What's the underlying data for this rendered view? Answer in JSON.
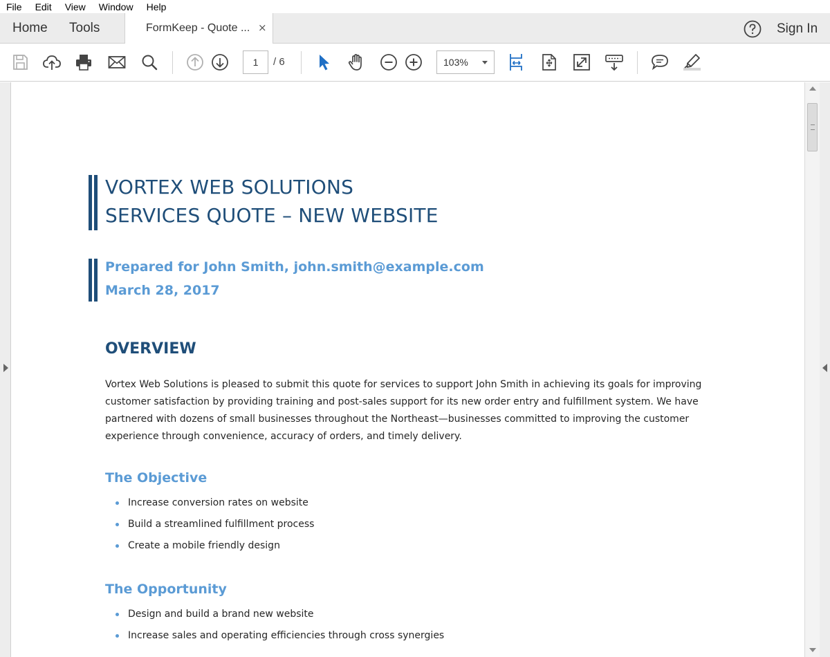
{
  "menu": [
    "File",
    "Edit",
    "View",
    "Window",
    "Help"
  ],
  "tabs": {
    "home": "Home",
    "tools": "Tools",
    "document_tab": "FormKeep - Quote ...",
    "close_glyph": "×",
    "sign_in": "Sign In"
  },
  "toolbar": {
    "page_current": "1",
    "page_total": "/ 6",
    "zoom": "103%",
    "active_color": "#1f6fc5"
  },
  "document": {
    "title_line1": "VORTEX WEB SOLUTIONS",
    "title_line2": "SERVICES QUOTE – NEW WEBSITE",
    "prepared_for": "Prepared for John Smith, john.smith@example.com",
    "date": "March 28, 2017",
    "overview_heading": "OVERVIEW",
    "overview_lines": [
      "Vortex Web Solutions is pleased to submit this quote for services to support John Smith in achieving its goals for improving",
      "customer satisfaction by providing training and post-sales support for its new order entry and fulfillment system. We have",
      "partnered with dozens of small businesses throughout the Northeast—businesses committed to improving the customer",
      "experience through convenience, accuracy of orders, and timely delivery."
    ],
    "objective_heading": "The Objective",
    "objective_items": [
      "Increase conversion rates on website",
      "Build a streamlined fulfillment process",
      "Create a mobile friendly design"
    ],
    "opportunity_heading": "The Opportunity",
    "opportunity_items": [
      "Design and build a brand new website",
      "Increase sales and operating efficiencies through cross synergies"
    ],
    "colors": {
      "heading_dark": "#1f4e79",
      "heading_light": "#5b9bd5"
    }
  }
}
